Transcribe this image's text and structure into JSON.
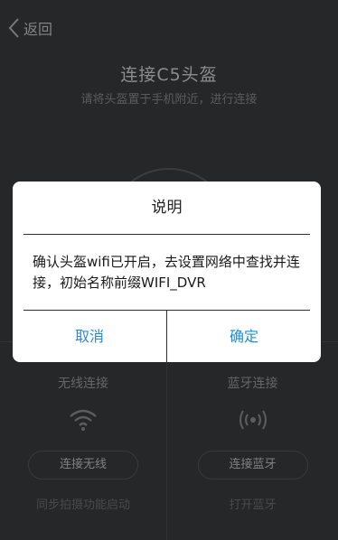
{
  "header": {
    "back_label": "返回"
  },
  "page": {
    "title": "连接C5头盔",
    "subtitle": "请将头盔置于手机附近，进行连接"
  },
  "options": {
    "wifi": {
      "title": "无线连接",
      "icon": "wifi-icon",
      "button_label": "连接无线",
      "footer": "同步拍摄功能启动"
    },
    "bluetooth": {
      "title": "蓝牙连接",
      "icon": "bluetooth-signal-icon",
      "button_label": "连接蓝牙",
      "footer": "打开蓝牙"
    }
  },
  "dialog": {
    "title": "说明",
    "message": "确认头盔wifi已开启，去设置网络中查找并连接，初始名称前缀WIFI_DVR",
    "cancel_label": "取消",
    "ok_label": "确定",
    "button_color": "#1e8fd8"
  }
}
